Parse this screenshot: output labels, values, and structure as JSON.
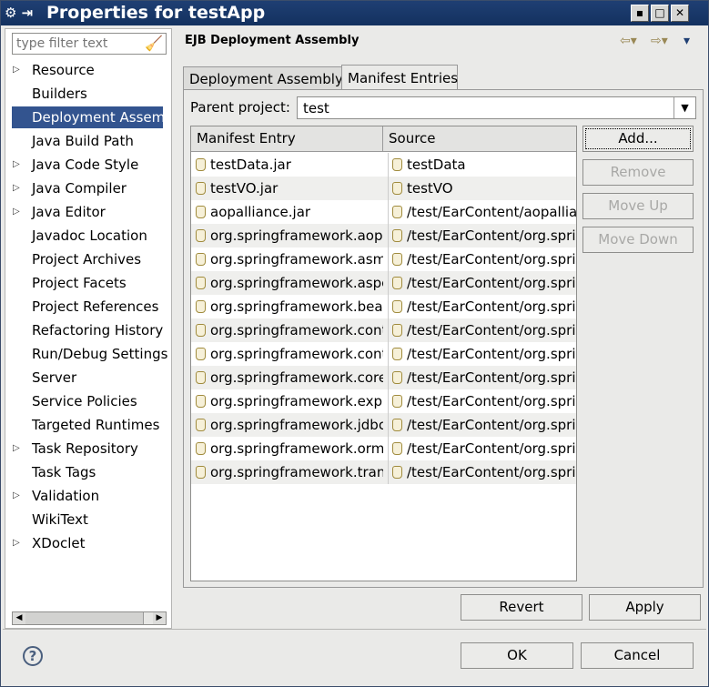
{
  "window": {
    "title": "Properties for testApp"
  },
  "filter": {
    "placeholder": "type filter text"
  },
  "tree": [
    {
      "label": "Resource",
      "expandable": true
    },
    {
      "label": "Builders",
      "expandable": false
    },
    {
      "label": "Deployment Assem",
      "expandable": false,
      "selected": true
    },
    {
      "label": "Java Build Path",
      "expandable": false
    },
    {
      "label": "Java Code Style",
      "expandable": true
    },
    {
      "label": "Java Compiler",
      "expandable": true
    },
    {
      "label": "Java Editor",
      "expandable": true
    },
    {
      "label": "Javadoc Location",
      "expandable": false
    },
    {
      "label": "Project Archives",
      "expandable": false
    },
    {
      "label": "Project Facets",
      "expandable": false
    },
    {
      "label": "Project References",
      "expandable": false
    },
    {
      "label": "Refactoring History",
      "expandable": false
    },
    {
      "label": "Run/Debug Settings",
      "expandable": false
    },
    {
      "label": "Server",
      "expandable": false
    },
    {
      "label": "Service Policies",
      "expandable": false
    },
    {
      "label": "Targeted Runtimes",
      "expandable": false
    },
    {
      "label": "Task Repository",
      "expandable": true
    },
    {
      "label": "Task Tags",
      "expandable": false
    },
    {
      "label": "Validation",
      "expandable": true
    },
    {
      "label": "WikiText",
      "expandable": false
    },
    {
      "label": "XDoclet",
      "expandable": true
    }
  ],
  "page": {
    "title": "EJB Deployment Assembly"
  },
  "tabs": [
    {
      "label": "Deployment Assembly",
      "active": false
    },
    {
      "label": "Manifest Entries",
      "active": true
    }
  ],
  "parent_project": {
    "label": "Parent project:",
    "value": "test"
  },
  "table": {
    "columns": [
      "Manifest Entry",
      "Source"
    ],
    "rows": [
      [
        "testData.jar",
        "testData"
      ],
      [
        "testVO.jar",
        "testVO"
      ],
      [
        "aopalliance.jar",
        "/test/EarContent/aopallian"
      ],
      [
        "org.springframework.aop-",
        "/test/EarContent/org.sprin"
      ],
      [
        "org.springframework.asm",
        "/test/EarContent/org.sprin"
      ],
      [
        "org.springframework.aspe",
        "/test/EarContent/org.sprin"
      ],
      [
        "org.springframework.bear",
        "/test/EarContent/org.sprin"
      ],
      [
        "org.springframework.cont",
        "/test/EarContent/org.sprin"
      ],
      [
        "org.springframework.cont",
        "/test/EarContent/org.sprin"
      ],
      [
        "org.springframework.core",
        "/test/EarContent/org.sprin"
      ],
      [
        "org.springframework.expr",
        "/test/EarContent/org.sprin"
      ],
      [
        "org.springframework.jdbc",
        "/test/EarContent/org.sprin"
      ],
      [
        "org.springframework.orm",
        "/test/EarContent/org.sprin"
      ],
      [
        "org.springframework.tran",
        "/test/EarContent/org.sprin"
      ]
    ]
  },
  "buttons": {
    "add": "Add...",
    "remove": "Remove",
    "move_up": "Move Up",
    "move_down": "Move Down",
    "revert": "Revert",
    "apply": "Apply",
    "ok": "OK",
    "cancel": "Cancel"
  }
}
